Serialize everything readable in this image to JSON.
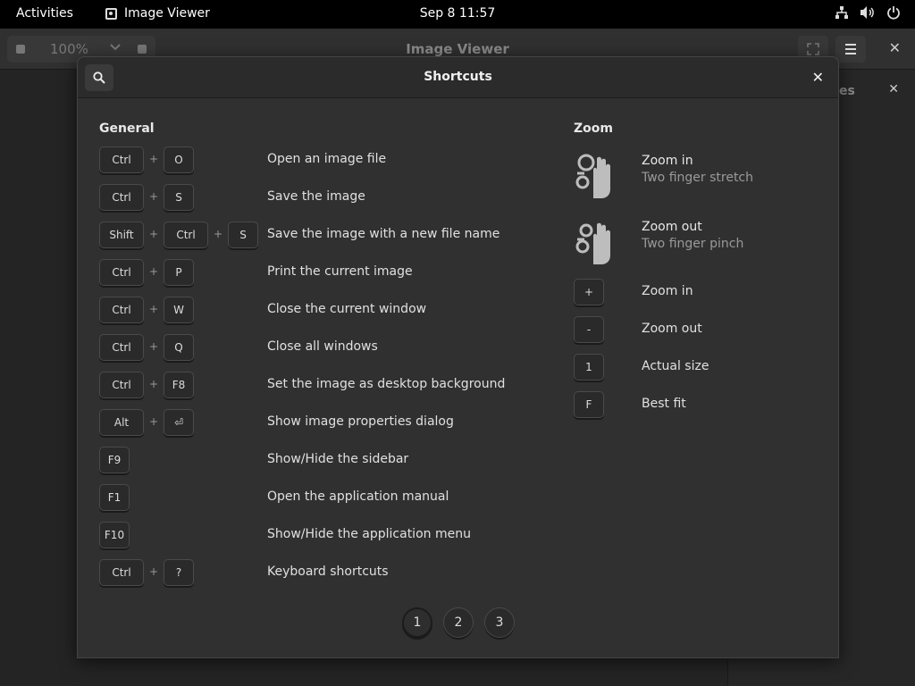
{
  "topbar": {
    "activities": "Activities",
    "app_name": "Image Viewer",
    "clock": "Sep 8  11:57",
    "icons": [
      "network-icon",
      "volume-icon",
      "power-icon"
    ]
  },
  "viewer": {
    "zoom_value": "100%",
    "title": "Image Viewer",
    "sidebar_title_fragment": "es"
  },
  "dialog": {
    "title": "Shortcuts",
    "general": {
      "title": "General",
      "shortcuts": [
        {
          "keys": [
            "Ctrl",
            "O"
          ],
          "desc": "Open an image file"
        },
        {
          "keys": [
            "Ctrl",
            "S"
          ],
          "desc": "Save the image"
        },
        {
          "keys": [
            "Shift",
            "Ctrl",
            "S"
          ],
          "desc": "Save the image with a new file name"
        },
        {
          "keys": [
            "Ctrl",
            "P"
          ],
          "desc": "Print the current image"
        },
        {
          "keys": [
            "Ctrl",
            "W"
          ],
          "desc": "Close the current window"
        },
        {
          "keys": [
            "Ctrl",
            "Q"
          ],
          "desc": "Close all windows"
        },
        {
          "keys": [
            "Ctrl",
            "F8"
          ],
          "desc": "Set the image as desktop background"
        },
        {
          "keys": [
            "Alt",
            "⏎"
          ],
          "desc": "Show image properties dialog"
        },
        {
          "keys": [
            "F9"
          ],
          "desc": "Show/Hide the sidebar"
        },
        {
          "keys": [
            "F1"
          ],
          "desc": "Open the application manual"
        },
        {
          "keys": [
            "F10"
          ],
          "desc": "Show/Hide the application menu"
        },
        {
          "keys": [
            "Ctrl",
            "?"
          ],
          "desc": "Keyboard shortcuts"
        }
      ]
    },
    "zoom": {
      "title": "Zoom",
      "gestures": [
        {
          "title": "Zoom in",
          "subtitle": "Two finger stretch"
        },
        {
          "title": "Zoom out",
          "subtitle": "Two finger pinch"
        }
      ],
      "shortcuts": [
        {
          "key": "+",
          "desc": "Zoom in"
        },
        {
          "key": "-",
          "desc": "Zoom out"
        },
        {
          "key": "1",
          "desc": "Actual size"
        },
        {
          "key": "F",
          "desc": "Best fit"
        }
      ]
    },
    "pages": [
      "1",
      "2",
      "3"
    ],
    "active_page": "1"
  }
}
